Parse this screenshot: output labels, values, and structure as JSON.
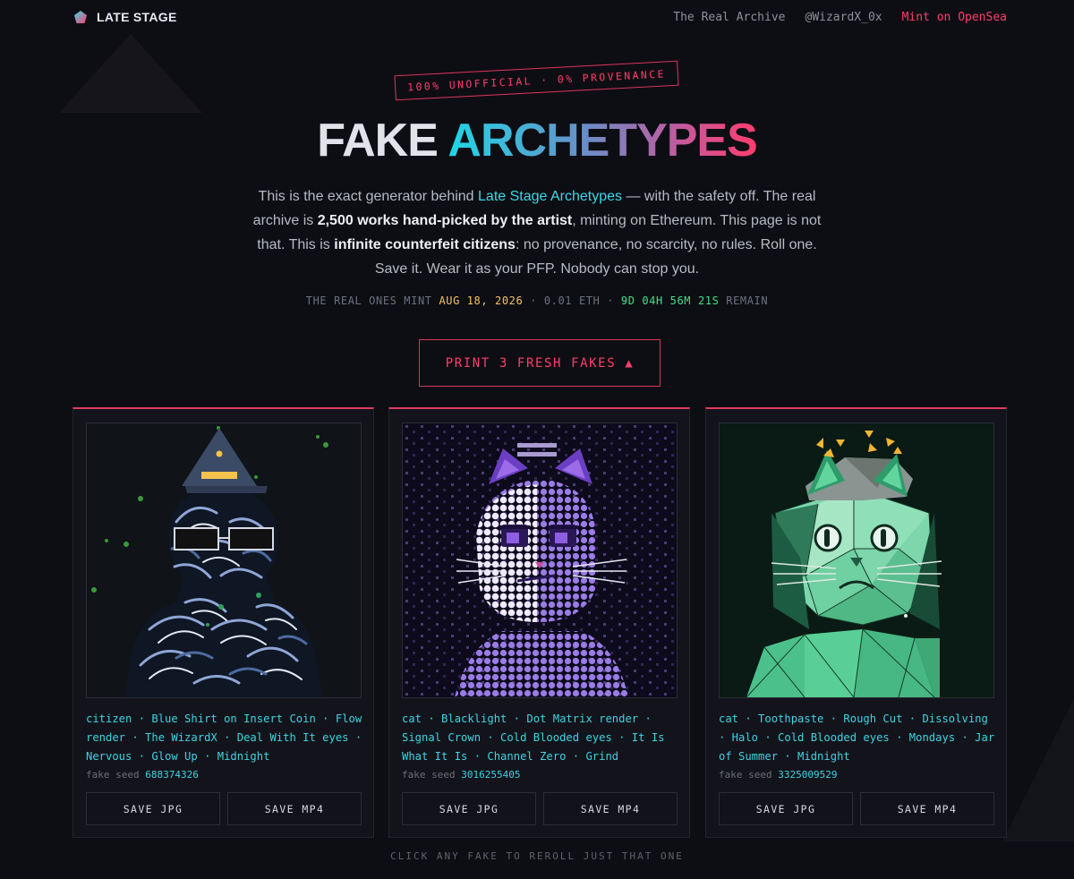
{
  "brand": {
    "name": "LATE STAGE"
  },
  "nav": [
    {
      "label": "The Real Archive"
    },
    {
      "label": "@WizardX_0x"
    },
    {
      "label": "Mint on OpenSea"
    }
  ],
  "hero": {
    "badge": "100% UNOFFICIAL · 0% PROVENANCE",
    "title_plain": "FAKE",
    "title_gradient": "ARCHETYPES",
    "intro": {
      "p1": "This is the exact generator behind ",
      "link": "Late Stage Archetypes",
      "p2": " — with the safety off. The real archive is ",
      "b1": "2,500 works hand-picked by the artist",
      "p3": ", minting on Ethereum. This page is not that. This is ",
      "b2": "infinite counterfeit citizens",
      "p4": ": no provenance, no scarcity, no rules. Roll one. Save it. Wear it as your PFP. Nobody can stop you."
    },
    "mint": {
      "prefix": "THE REAL ONES MINT ",
      "date": "AUG 18, 2026",
      "middle": " · 0.01 ETH · ",
      "countdown": "9D 04H 56M 21S",
      "suffix": " REMAIN"
    },
    "cta_label": "PRINT 3 FRESH FAKES ▲"
  },
  "cards": [
    {
      "traits": "citizen · Blue Shirt on Insert Coin · Flow render · The WizardX · Deal With It eyes · Nervous · Glow Up · Midnight",
      "seed_label": "fake seed",
      "seed": "688374326",
      "save_jpg": "SAVE JPG",
      "save_mp4": "SAVE MP4"
    },
    {
      "traits": "cat · Blacklight · Dot Matrix render · Signal Crown · Cold Blooded eyes · It Is What It Is · Channel Zero · Grind",
      "seed_label": "fake seed",
      "seed": "3016255405",
      "save_jpg": "SAVE JPG",
      "save_mp4": "SAVE MP4"
    },
    {
      "traits": "cat · Toothpaste · Rough Cut · Dissolving · Halo · Cold Blooded eyes · Mondays · Jar of Summer · Midnight",
      "seed_label": "fake seed",
      "seed": "3325009529",
      "save_jpg": "SAVE JPG",
      "save_mp4": "SAVE MP4"
    }
  ],
  "footer_hint": "CLICK ANY FAKE TO REROLL JUST THAT ONE",
  "colors": {
    "accent": "#ff3d6e",
    "cyan": "#3fd3e3",
    "date": "#f5c16a",
    "countdown": "#42e08c",
    "background": "#0d0e13"
  }
}
